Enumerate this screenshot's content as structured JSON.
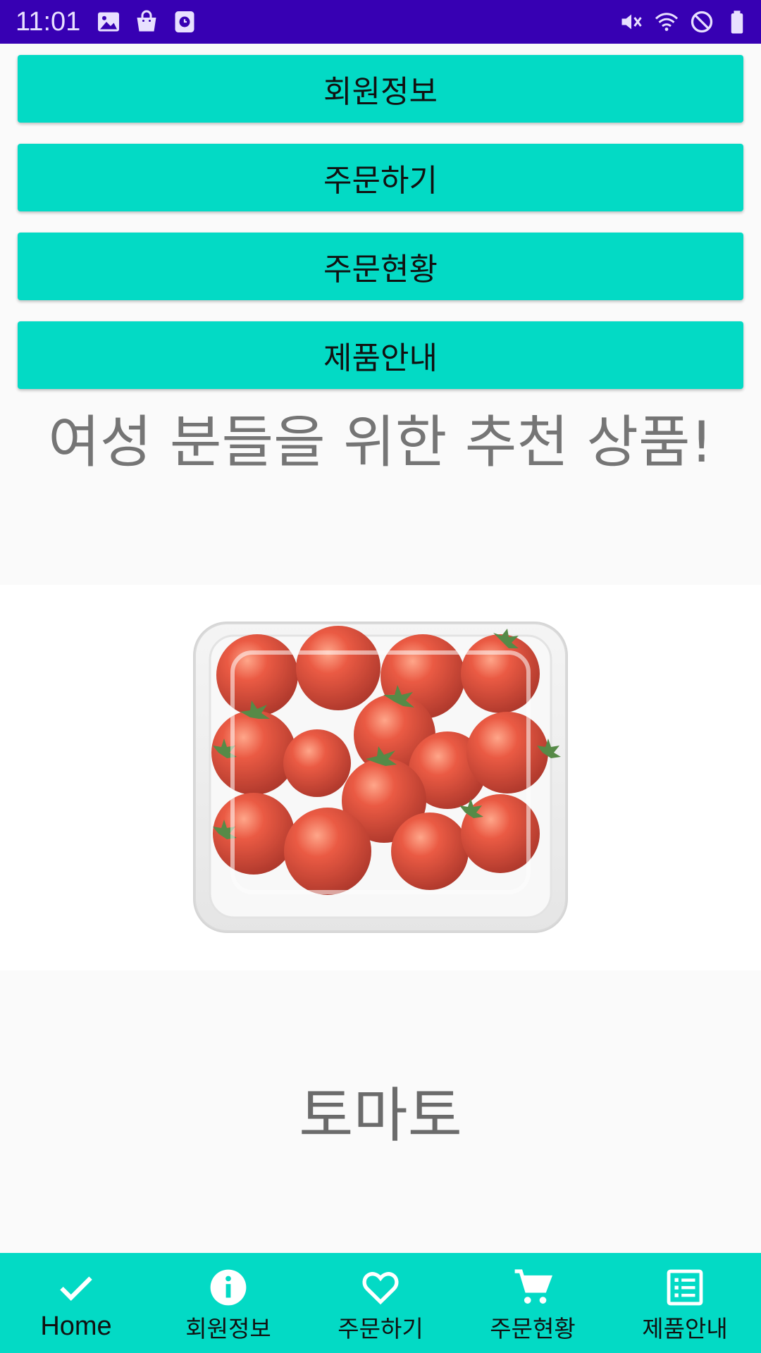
{
  "status_bar": {
    "time": "11:01",
    "left_icons": [
      "image-icon",
      "shopping-bag-icon",
      "clock-badge-icon"
    ],
    "right_icons": [
      "vibrate-mute-icon",
      "wifi-icon",
      "do-not-disturb-icon",
      "battery-icon"
    ],
    "background": "#3700b3"
  },
  "menu_buttons": [
    {
      "label": "회원정보"
    },
    {
      "label": "주문하기"
    },
    {
      "label": "주문현황"
    },
    {
      "label": "제품안내"
    }
  ],
  "promo": {
    "heading": "여성 분들을 위한 추천 상품!",
    "product_image": "cherry-tomatoes-in-plastic-container",
    "product_name": "토마토"
  },
  "bottom_nav": {
    "items": [
      {
        "label": "Home",
        "icon": "check-icon",
        "active": true
      },
      {
        "label": "회원정보",
        "icon": "info-icon",
        "active": false
      },
      {
        "label": "주문하기",
        "icon": "heart-icon",
        "active": false
      },
      {
        "label": "주문현황",
        "icon": "cart-icon",
        "active": false
      },
      {
        "label": "제품안내",
        "icon": "list-icon",
        "active": false
      }
    ]
  },
  "colors": {
    "accent": "#03dac5",
    "primary_dark": "#3700b3",
    "text_gray": "#757575"
  }
}
